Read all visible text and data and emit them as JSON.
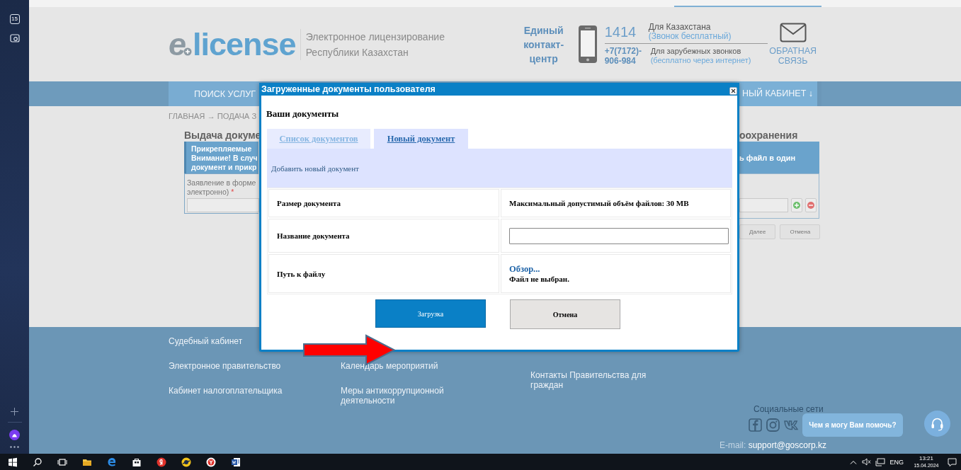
{
  "os_panel": {
    "badge": "15"
  },
  "header": {
    "logo": {
      "mark": "e",
      "name": "license"
    },
    "tagline": [
      "Электронное лицензирование",
      "Республики Казахстан"
    ],
    "contact_center": "Единый контакт-центр",
    "hotline": {
      "number": "1414",
      "region": "Для Казахстана",
      "note": "(Звонок бесплатный)"
    },
    "international": {
      "number_lines": [
        "+7(7172)-",
        "906-984"
      ],
      "region": "Для зарубежных звонков",
      "note": "(бесплатно через интернет)"
    },
    "feedback": "ОБРАТНАЯ СВЯЗЬ"
  },
  "nav": [
    "ПОИСК УСЛУГ",
    "НЫЙ КАБИНЕТ ↓"
  ],
  "breadcrumb": "ГЛАВНАЯ → ПОДАЧА З",
  "form_left": {
    "title": "Выдача докуме",
    "notice": [
      "Прикрепляемые",
      "Внимание! В случ",
      "документ и прикр"
    ],
    "field_label": [
      "Заявление в форме",
      "электронно)"
    ],
    "required": "*"
  },
  "form_right": {
    "title": "оохранения",
    "notice": "ь файл в один",
    "buttons": [
      "Далее",
      "Отмена"
    ]
  },
  "modal": {
    "title": "Загруженные документы пользователя",
    "heading": "Ваши документы",
    "tabs": [
      {
        "label": "Список документов",
        "selected": false
      },
      {
        "label": "Новый документ",
        "selected": true
      }
    ],
    "panel_title": "Добавить новый документ",
    "rows": [
      {
        "kind": "text",
        "label": "Размер документа",
        "value": "Максимальный допустимый объём файлов: 30 MB"
      },
      {
        "kind": "input",
        "label": "Название документа"
      },
      {
        "kind": "file",
        "label": "Путь к файлу",
        "browse": "Обзор...",
        "status": "Файл не выбран."
      }
    ],
    "buttons": [
      {
        "label": "Загрузка",
        "kind": "primary"
      },
      {
        "label": "Отмена",
        "kind": "secondary"
      }
    ]
  },
  "footer": {
    "columns": [
      [
        "Судебный кабинет",
        "Электронное правительство",
        "Кабинет налогоплательщика"
      ],
      [
        "Календарь мероприятий",
        "Меры антикоррупционной деятельности"
      ],
      [
        "Контакты Правительства для граждан"
      ]
    ],
    "social_title": "Социальные сети",
    "email_label": "E-mail:",
    "email": "support@goscorp.kz"
  },
  "chat": {
    "prompt": "Чем я могу Вам помочь?"
  },
  "taskbar": {
    "language": "ENG",
    "time": "13:21",
    "date": "15.04.2024"
  }
}
